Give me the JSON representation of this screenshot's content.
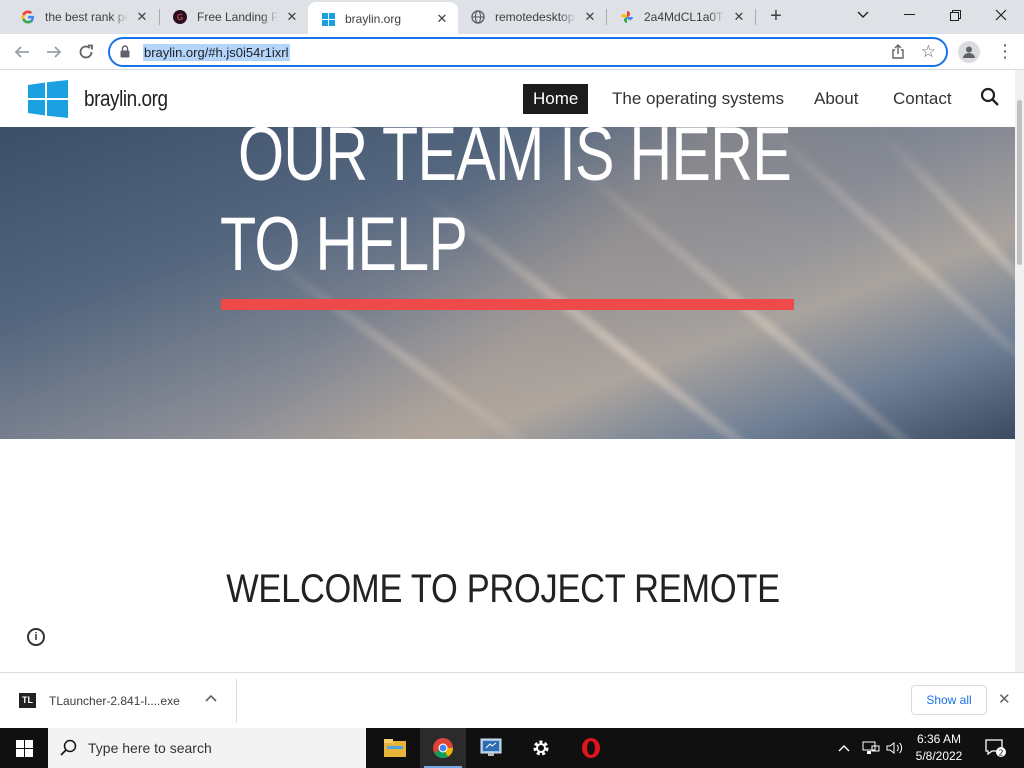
{
  "browser": {
    "tabs": [
      {
        "title": "the best rank pe",
        "favicon": "google-g-icon"
      },
      {
        "title": "Free Landing Pa",
        "favicon": "landing-page-icon"
      },
      {
        "title": "braylin.org",
        "favicon": "windows-logo-icon"
      },
      {
        "title": "remotedesktop",
        "favicon": "globe-icon"
      },
      {
        "title": "2a4MdCL1a0Tn",
        "favicon": "pinwheel-icon"
      }
    ],
    "url": "braylin.org/#h.js0i54r1ixrl"
  },
  "site": {
    "name": "braylin.org",
    "nav": [
      "Home",
      "The operating systems",
      "About",
      "Contact"
    ],
    "hero_line1": "OUR TEAM IS HERE",
    "hero_line2": "TO HELP",
    "welcome": "WELCOME TO PROJECT REMOTE",
    "accent_color": "#ef4a4a"
  },
  "downloads": {
    "file": "TLauncher-2.841-l....exe",
    "icon_text": "TL",
    "show_all": "Show all"
  },
  "taskbar": {
    "search_placeholder": "Type here to search",
    "time": "6:36 AM",
    "date": "5/8/2022",
    "notification_count": "2"
  }
}
